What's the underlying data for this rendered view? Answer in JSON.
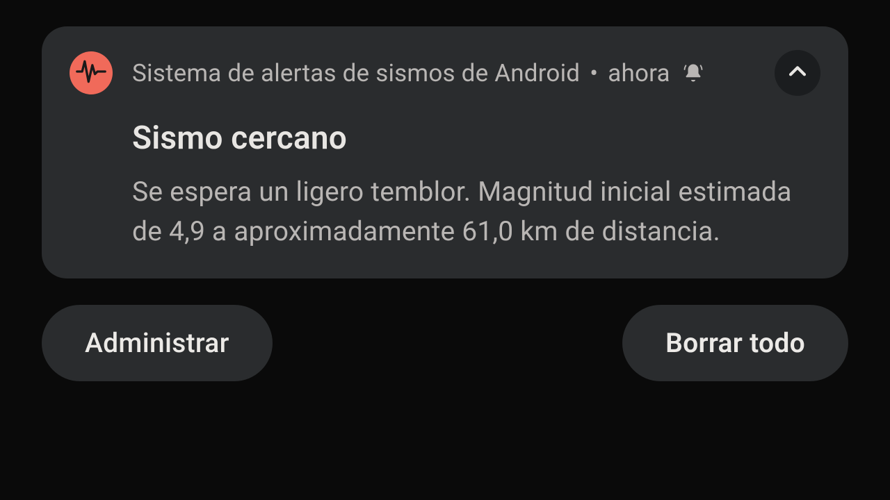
{
  "notification": {
    "app_name": "Sistema de alertas de sismos de Android",
    "separator": "•",
    "time": "ahora",
    "title": "Sismo cercano",
    "body": "Se espera un ligero temblor. Magnitud inicial estimada de 4,9 a aproximadamente 61,0 km de distancia.",
    "icon_name": "seismic-wave-icon",
    "alert_icon_name": "bell-ringing-icon",
    "accent_color": "#f06a5a"
  },
  "actions": {
    "manage_label": "Administrar",
    "clear_all_label": "Borrar todo"
  }
}
